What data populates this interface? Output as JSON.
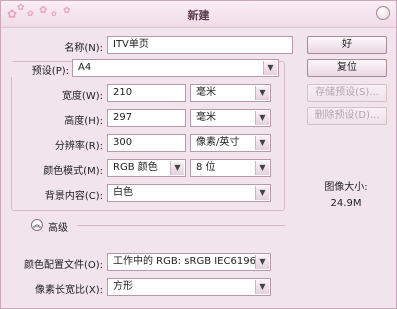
{
  "window": {
    "title": "新建",
    "close_icon": "close-icon"
  },
  "form": {
    "name": {
      "label": "名称(N):",
      "value": "ITV单页"
    },
    "preset": {
      "label": "预设(P):",
      "value": "A4"
    },
    "width": {
      "label": "宽度(W):",
      "value": "210",
      "unit": "毫米"
    },
    "height": {
      "label": "高度(H):",
      "value": "297",
      "unit": "毫米"
    },
    "resolution": {
      "label": "分辨率(R):",
      "value": "300",
      "unit": "像素/英寸"
    },
    "color_mode": {
      "label": "颜色模式(M):",
      "value": "RGB 颜色",
      "bits": "8 位"
    },
    "background": {
      "label": "背景内容(C):",
      "value": "白色"
    },
    "advanced": {
      "label": "高级"
    },
    "color_profile": {
      "label": "颜色配置文件(O):",
      "value": "工作中的 RGB: sRGB IEC6196..."
    },
    "pixel_aspect": {
      "label": "像素长宽比(X):",
      "value": "方形"
    }
  },
  "buttons": {
    "ok": "好",
    "reset": "复位",
    "save_preset": "存储预设(S)...",
    "delete_preset": "删除预设(D)..."
  },
  "image_size": {
    "label": "图像大小:",
    "value": "24.9M"
  }
}
